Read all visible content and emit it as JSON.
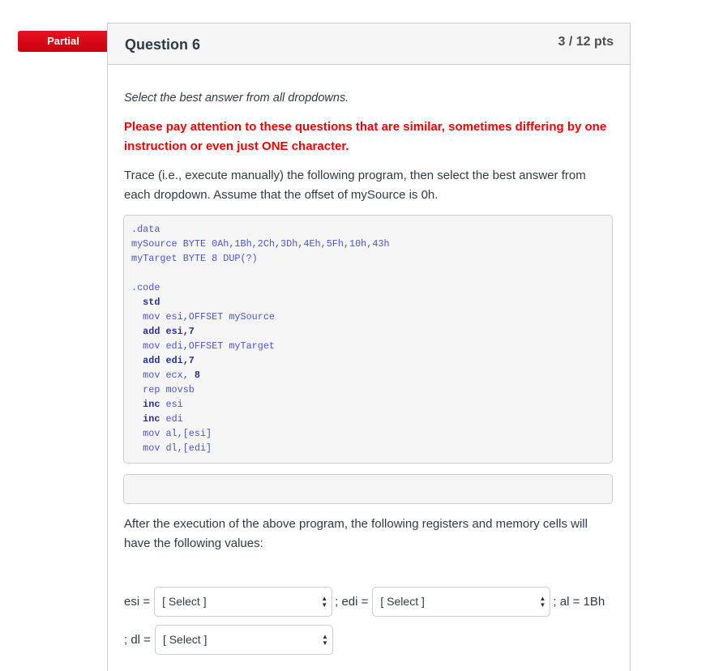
{
  "status_badge": "Partial",
  "question": {
    "title": "Question 6",
    "points": "3 / 12 pts",
    "intro": "Select the best answer from all dropdowns.",
    "warning": "Please pay attention to these questions that are similar, sometimes differing by one instruction or even just ONE character.",
    "trace": "Trace (i.e., execute manually) the following program, then select the best answer from each dropdown. Assume that the offset of mySource is 0h.",
    "code": [
      [
        {
          "t": ".data",
          "b": false
        }
      ],
      [
        {
          "t": "mySource BYTE 0Ah,1Bh,2Ch,3Dh,4Eh,5Fh,10h,43h",
          "b": false
        }
      ],
      [
        {
          "t": "myTarget BYTE 8 DUP(?)",
          "b": false
        }
      ],
      [],
      [
        {
          "t": ".code",
          "b": false
        }
      ],
      [
        {
          "t": "  ",
          "b": false
        },
        {
          "t": "std",
          "b": true
        }
      ],
      [
        {
          "t": "  mov esi,OFFSET mySource",
          "b": false
        }
      ],
      [
        {
          "t": "  ",
          "b": false
        },
        {
          "t": "add esi,7",
          "b": true
        }
      ],
      [
        {
          "t": "  mov edi,OFFSET myTarget",
          "b": false
        }
      ],
      [
        {
          "t": "  ",
          "b": false
        },
        {
          "t": "add edi,7",
          "b": true
        }
      ],
      [
        {
          "t": "  mov ecx, ",
          "b": false
        },
        {
          "t": "8",
          "b": true
        }
      ],
      [
        {
          "t": "  rep movsb",
          "b": false
        }
      ],
      [
        {
          "t": "  ",
          "b": false
        },
        {
          "t": "inc",
          "b": true
        },
        {
          "t": " esi",
          "b": false
        }
      ],
      [
        {
          "t": "  ",
          "b": false
        },
        {
          "t": "inc",
          "b": true
        },
        {
          "t": " edi",
          "b": false
        }
      ],
      [
        {
          "t": "  mov al,[esi]",
          "b": false
        }
      ],
      [
        {
          "t": "  mov dl,[edi]",
          "b": false
        }
      ]
    ],
    "after_text": "After the execution of the above  program, the following registers and memory cells will have the following values:",
    "answers": {
      "esi_label": "esi =",
      "esi_select": "[ Select ]",
      "edi_label": "; edi =",
      "edi_select": "[ Select ]",
      "al_text": "; al = 1Bh",
      "dl_label": "; dl =",
      "dl_select": "[ Select ]"
    }
  },
  "icons": {
    "select_arrows": "▲▼"
  }
}
